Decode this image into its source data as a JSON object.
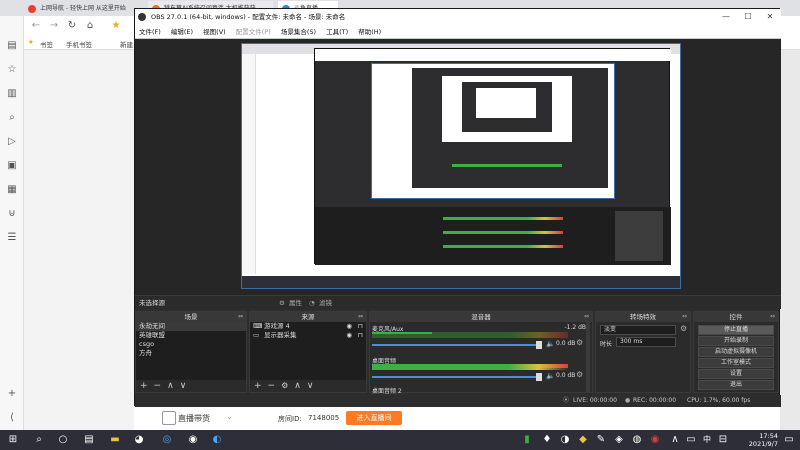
{
  "browser": {
    "tabs": [
      {
        "label": "上网导航 - 轻快上网 从这里开始",
        "color": "#e6412f"
      },
      {
        "label": "特东蔡AI系统召问意连 大机推获获...",
        "color": "#ff6a00"
      },
      {
        "label": "斗鱼直播",
        "color": "#1e88e5"
      }
    ],
    "bookmarks": [
      "书签",
      "手机书签",
      "新建"
    ],
    "page_bottom": {
      "label": "直播带货",
      "room_id_label": "房间ID:",
      "room_id": "7148005",
      "enter_button": "进入直播间"
    }
  },
  "obs": {
    "title": "OBS 27.0.1 (64-bit, windows) - 配置文件: 未命名 - 场景: 未命名",
    "menu": [
      "文件(F)",
      "编辑(E)",
      "视图(V)",
      "配置文件(P)",
      "场景集合(S)",
      "工具(T)",
      "帮助(H)"
    ],
    "no_source": "未选择源",
    "props_btn": "属性",
    "filters_btn": "滤镜",
    "docks": {
      "scenes": {
        "title": "场景",
        "items": [
          "永劫无间",
          "英雄联盟",
          "csgo",
          "方舟"
        ]
      },
      "sources": {
        "title": "来源",
        "items": [
          "游戏源 4",
          "显示器采集"
        ]
      },
      "mixer": {
        "title": "混音器",
        "channels": [
          {
            "name": "麦克风/Aux",
            "db": "-1.2 dB",
            "vol": "0.0 dB"
          },
          {
            "name": "桌面音频",
            "db": "",
            "vol": "0.0 dB"
          },
          {
            "name": "桌面音频 2",
            "db": "",
            "vol": ""
          }
        ]
      },
      "transitions": {
        "title": "转场特效",
        "type": "淡变",
        "duration_label": "时长",
        "duration": "300 ms"
      },
      "controls": {
        "title": "控件",
        "buttons": [
          "停止直播",
          "开始录制",
          "启动虚拟摄像机",
          "工作室模式",
          "设置",
          "退出"
        ]
      }
    },
    "status": {
      "live": "LIVE: 00:00:00",
      "rec": "REC: 00:00:00",
      "cpu": "CPU: 1.7%, 60.00 fps"
    }
  },
  "taskbar": {
    "time": "17:54",
    "date": "2021/9/7",
    "ime": "中"
  }
}
